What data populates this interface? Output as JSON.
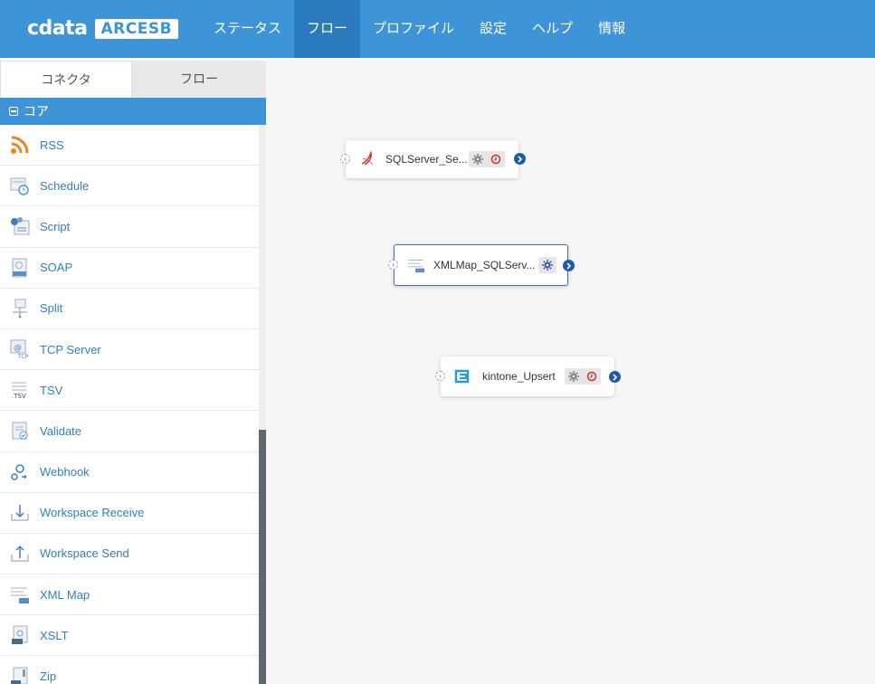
{
  "header": {
    "logo_text": "cdata",
    "logo_badge": "ARCESB",
    "nav": [
      {
        "label": "ステータス",
        "active": false
      },
      {
        "label": "フロー",
        "active": true
      },
      {
        "label": "プロファイル",
        "active": false
      },
      {
        "label": "設定",
        "active": false
      },
      {
        "label": "ヘルプ",
        "active": false
      },
      {
        "label": "情報",
        "active": false
      }
    ]
  },
  "sidebar": {
    "tabs": [
      {
        "label": "コネクタ",
        "active": true
      },
      {
        "label": "フロー",
        "active": false
      }
    ],
    "section": "コア",
    "items": [
      {
        "label": "RSS",
        "icon": "rss-icon"
      },
      {
        "label": "Schedule",
        "icon": "schedule-icon"
      },
      {
        "label": "Script",
        "icon": "script-icon"
      },
      {
        "label": "SOAP",
        "icon": "soap-icon"
      },
      {
        "label": "Split",
        "icon": "split-icon"
      },
      {
        "label": "TCP Server",
        "icon": "tcp-server-icon"
      },
      {
        "label": "TSV",
        "icon": "tsv-icon"
      },
      {
        "label": "Validate",
        "icon": "validate-icon"
      },
      {
        "label": "Webhook",
        "icon": "webhook-icon"
      },
      {
        "label": "Workspace Receive",
        "icon": "workspace-receive-icon"
      },
      {
        "label": "Workspace Send",
        "icon": "workspace-send-icon"
      },
      {
        "label": "XML Map",
        "icon": "xml-map-icon"
      },
      {
        "label": "XSLT",
        "icon": "xslt-icon"
      },
      {
        "label": "Zip",
        "icon": "zip-icon"
      }
    ]
  },
  "canvas": {
    "nodes": [
      {
        "name": "SQLServer_Se...",
        "icon": "sqlserver-icon",
        "selected": false,
        "buttons": [
          "gear-icon",
          "clock-icon"
        ]
      },
      {
        "name": "XMLMap_SQLServ...",
        "icon": "xml-map-icon",
        "selected": true,
        "buttons": [
          "gear-icon"
        ]
      },
      {
        "name": "kintone_Upsert",
        "icon": "kintone-icon",
        "selected": false,
        "buttons": [
          "gear-icon",
          "clock-icon"
        ]
      }
    ]
  },
  "colors": {
    "header": "#3d95d8",
    "nav_active": "#2a7bbd",
    "link": "#2f7fbf",
    "port": "#1e5aa8",
    "clock": "#c0392b"
  }
}
